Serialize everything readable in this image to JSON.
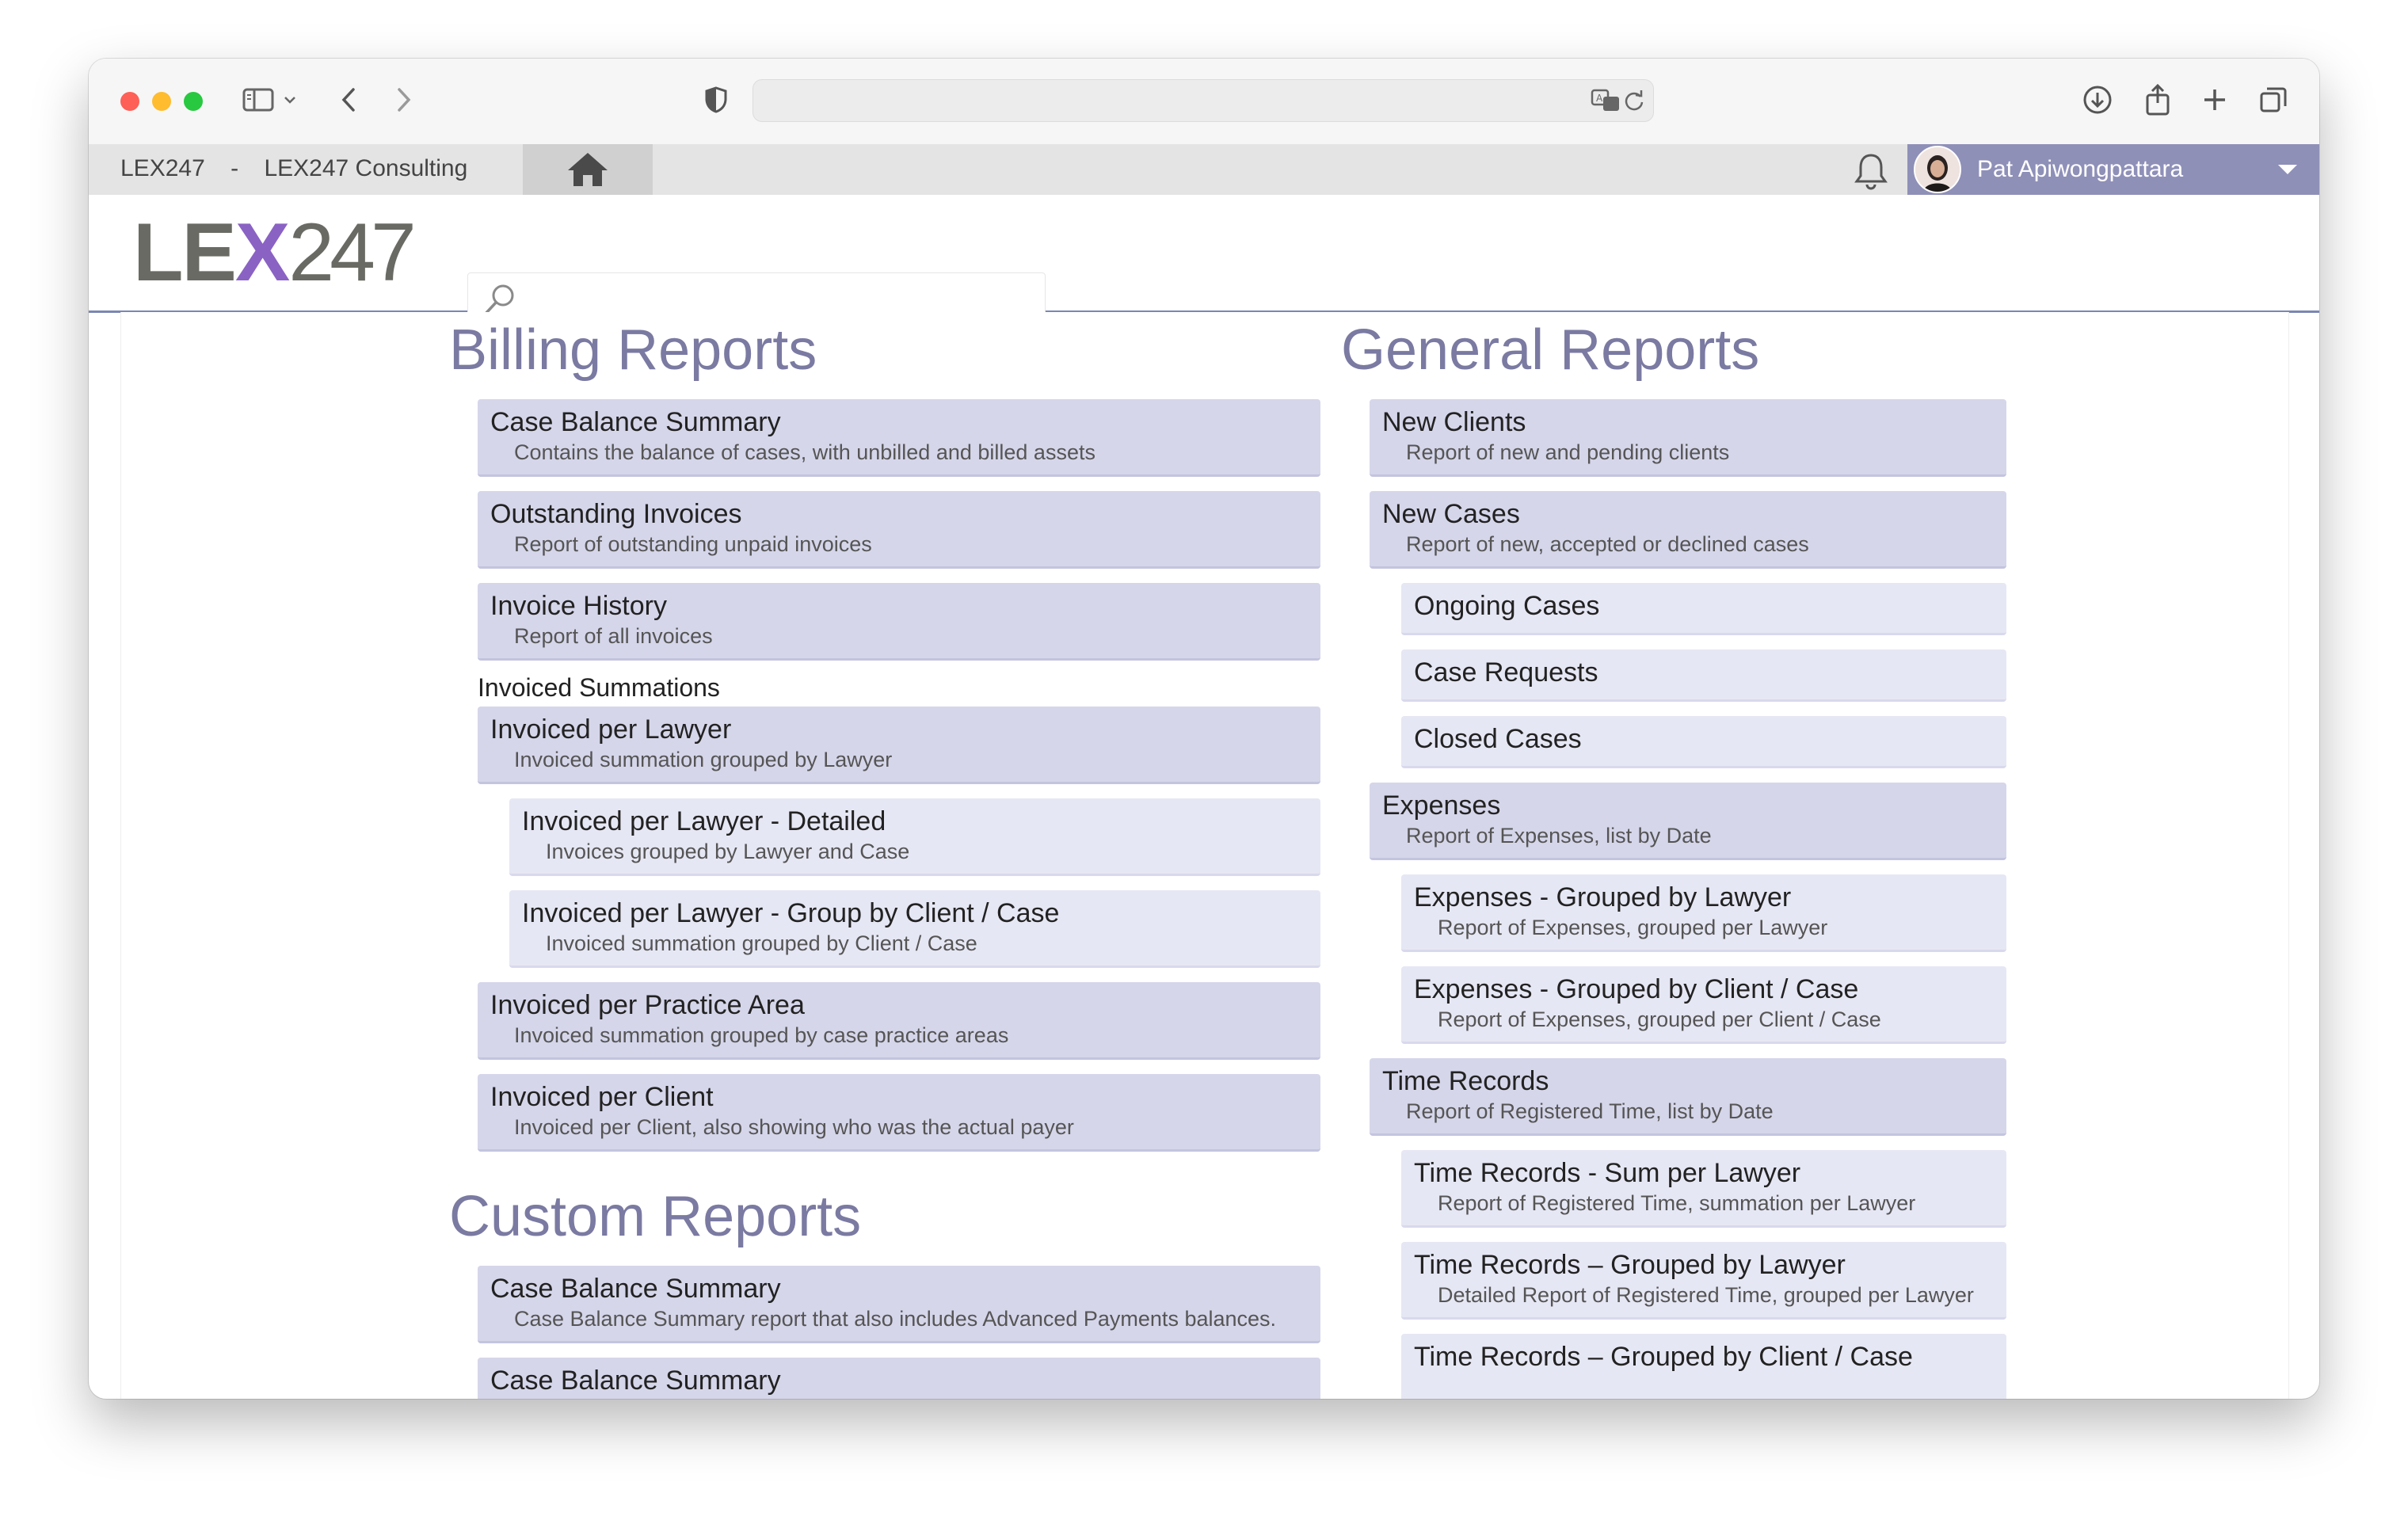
{
  "browser": {
    "url": "",
    "icons": [
      "sidebar-icon",
      "chevron-down-icon",
      "back-icon",
      "forward-icon",
      "shield-icon",
      "translate-icon",
      "reload-icon",
      "download-icon",
      "share-icon",
      "plus-icon",
      "tabs-icon"
    ]
  },
  "appbar": {
    "org_code": "LEX247",
    "separator": "-",
    "org_name": "LEX247 Consulting",
    "user_name": "Pat Apiwongpattara"
  },
  "logo": {
    "part1": "LE",
    "part2": "X",
    "part3": "247"
  },
  "search": {
    "placeholder": ""
  },
  "billing": {
    "title": "Billing Reports",
    "items": [
      {
        "title": "Case Balance Summary",
        "desc": "Contains the balance of cases, with unbilled and billed assets"
      },
      {
        "title": "Outstanding Invoices",
        "desc": "Report of outstanding unpaid invoices"
      },
      {
        "title": "Invoice History",
        "desc": "Report of all invoices"
      }
    ],
    "group_label": "Invoiced Summations",
    "group_items": [
      {
        "title": "Invoiced per Lawyer",
        "desc": "Invoiced summation grouped by Lawyer"
      },
      {
        "title": "Invoiced per Lawyer - Detailed",
        "desc": "Invoices grouped by Lawyer and Case"
      },
      {
        "title": "Invoiced per Lawyer - Group by Client / Case",
        "desc": "Invoiced summation grouped by Client / Case"
      },
      {
        "title": "Invoiced per Practice Area",
        "desc": "Invoiced summation grouped by case practice areas"
      },
      {
        "title": "Invoiced per Client",
        "desc": "Invoiced per Client, also showing who was the actual payer"
      }
    ]
  },
  "custom": {
    "title": "Custom Reports",
    "items": [
      {
        "title": "Case Balance Summary",
        "desc": "Case Balance Summary report that also includes Advanced Payments balances."
      },
      {
        "title": "Case Balance Summary",
        "desc": ""
      }
    ]
  },
  "general": {
    "title": "General Reports",
    "items": [
      {
        "title": "New Clients",
        "desc": "Report of new and pending clients"
      },
      {
        "title": "New Cases",
        "desc": "Report of new, accepted or declined cases"
      },
      {
        "title": "Ongoing Cases",
        "desc": ""
      },
      {
        "title": "Case Requests",
        "desc": ""
      },
      {
        "title": "Closed Cases",
        "desc": ""
      },
      {
        "title": "Expenses",
        "desc": "Report of Expenses, list by Date"
      },
      {
        "title": "Expenses - Grouped by Lawyer",
        "desc": "Report of Expenses, grouped per Lawyer"
      },
      {
        "title": "Expenses - Grouped by Client / Case",
        "desc": "Report of Expenses, grouped per Client / Case"
      },
      {
        "title": "Time Records",
        "desc": "Report of Registered Time, list by Date"
      },
      {
        "title": "Time Records - Sum per Lawyer",
        "desc": "Report of Registered Time, summation per Lawyer"
      },
      {
        "title": "Time Records – Grouped by Lawyer",
        "desc": "Detailed Report of Registered Time, grouped per Lawyer"
      },
      {
        "title": "Time Records – Grouped by Client / Case",
        "desc": ""
      }
    ]
  }
}
